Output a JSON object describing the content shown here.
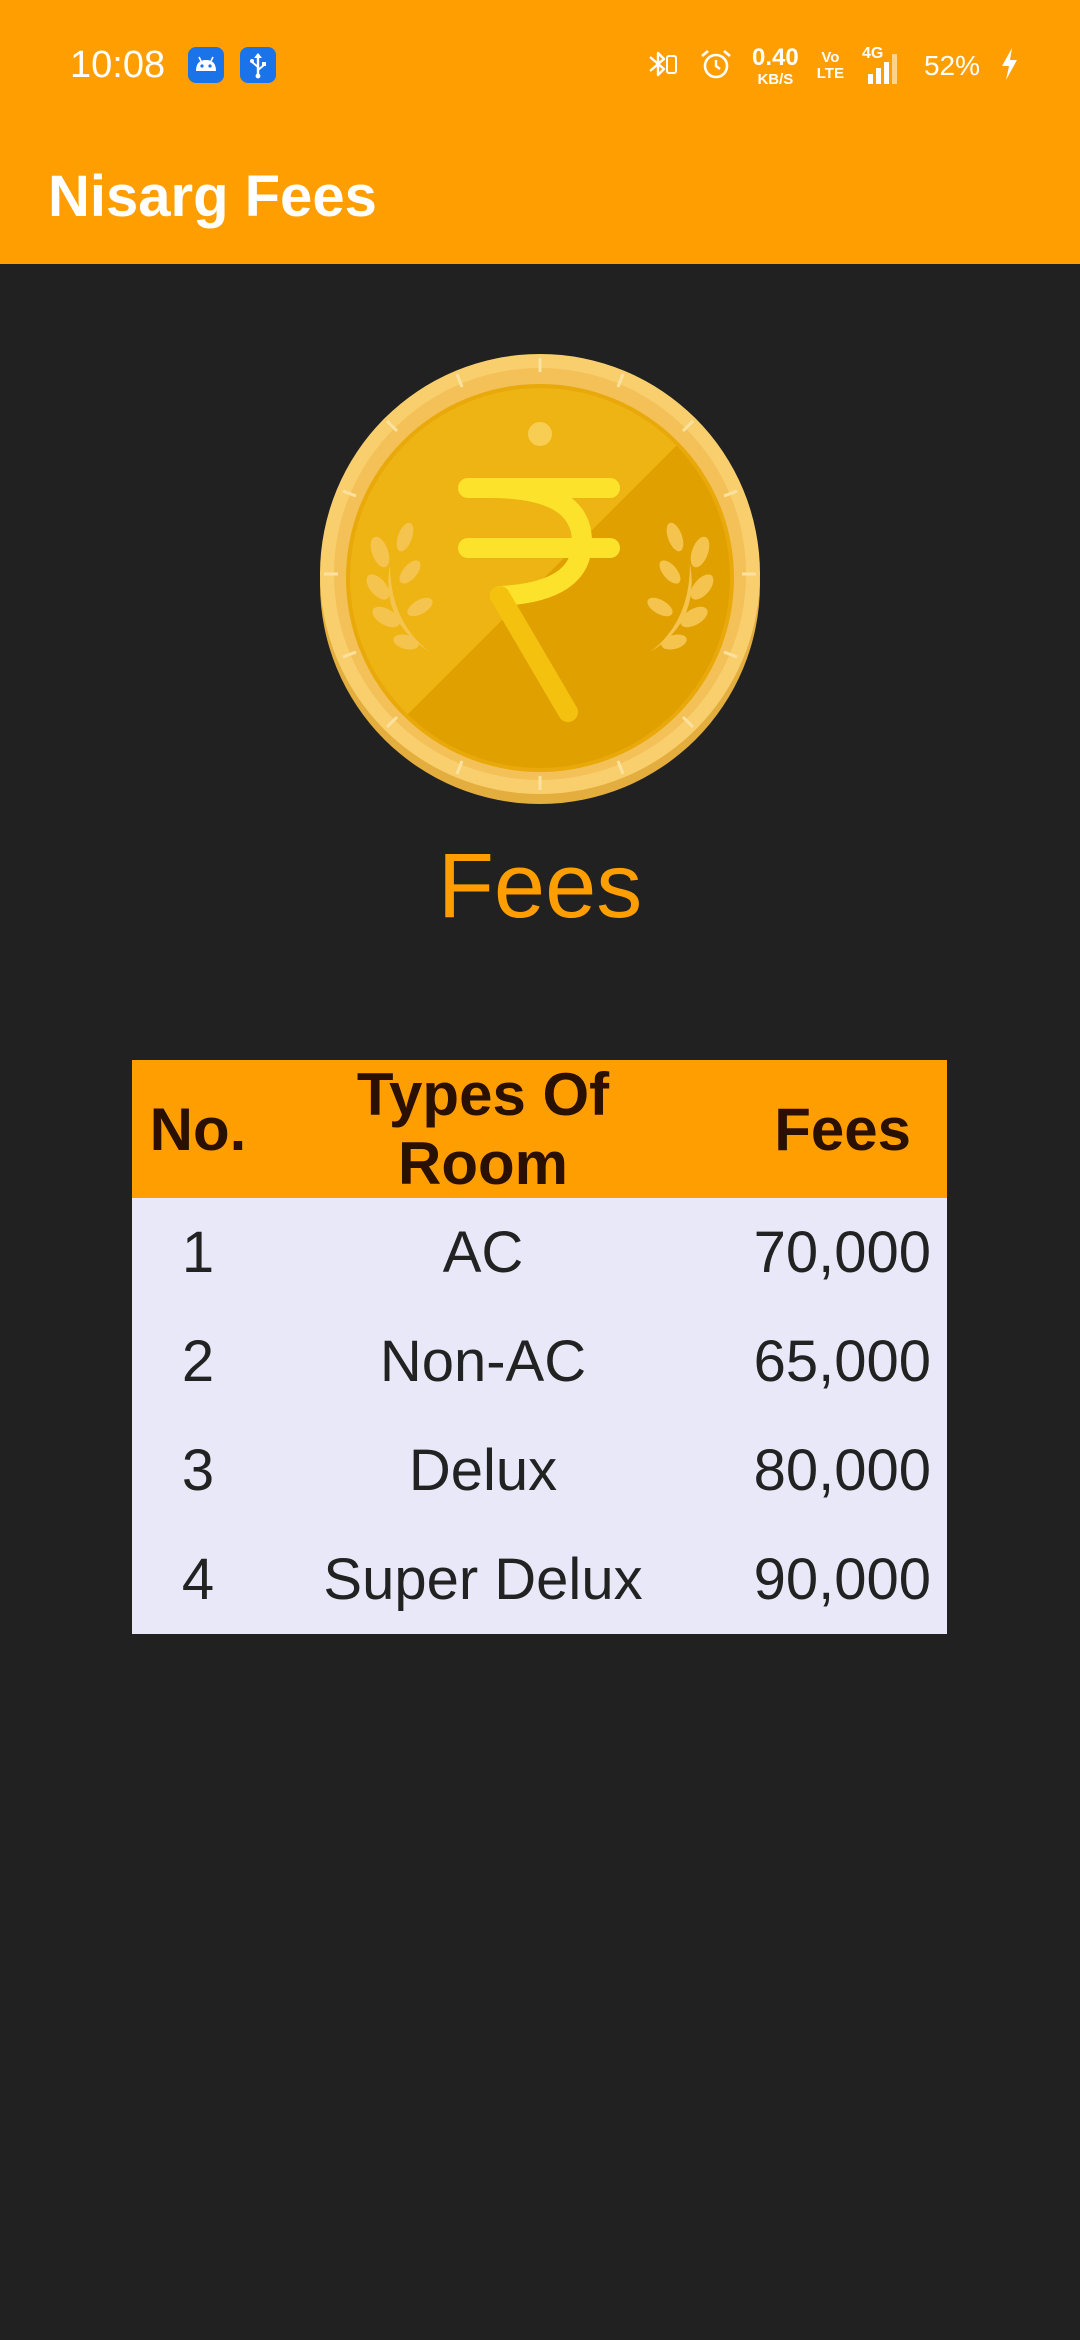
{
  "status_bar": {
    "time": "10:08",
    "net_speed_value": "0.40",
    "net_speed_unit": "KB/S",
    "volte_top": "Vo",
    "volte_bottom": "LTE",
    "network_type": "4G",
    "battery": "52%",
    "icons": [
      "android-icon",
      "usb-icon",
      "bluetooth-icon",
      "alarm-icon",
      "signal-icon",
      "charging-icon"
    ]
  },
  "app_bar": {
    "title": "Nisarg Fees",
    "color": "#FF9E00"
  },
  "hero": {
    "icon": "rupee-coin-icon",
    "heading": "Fees"
  },
  "fees_table": {
    "headers": [
      "No.",
      "Types Of Room",
      "Fees"
    ],
    "rows": [
      {
        "no": "1",
        "type": "AC",
        "fees": "70,000"
      },
      {
        "no": "2",
        "type": "Non-AC",
        "fees": "65,000"
      },
      {
        "no": "3",
        "type": "Delux",
        "fees": "80,000"
      },
      {
        "no": "4",
        "type": "Super Delux",
        "fees": "90,000"
      }
    ],
    "header_color": "#FF9E00",
    "row_color": "#E8E8F8"
  },
  "theme": {
    "background": "#212121",
    "accent": "#FF9E00"
  }
}
